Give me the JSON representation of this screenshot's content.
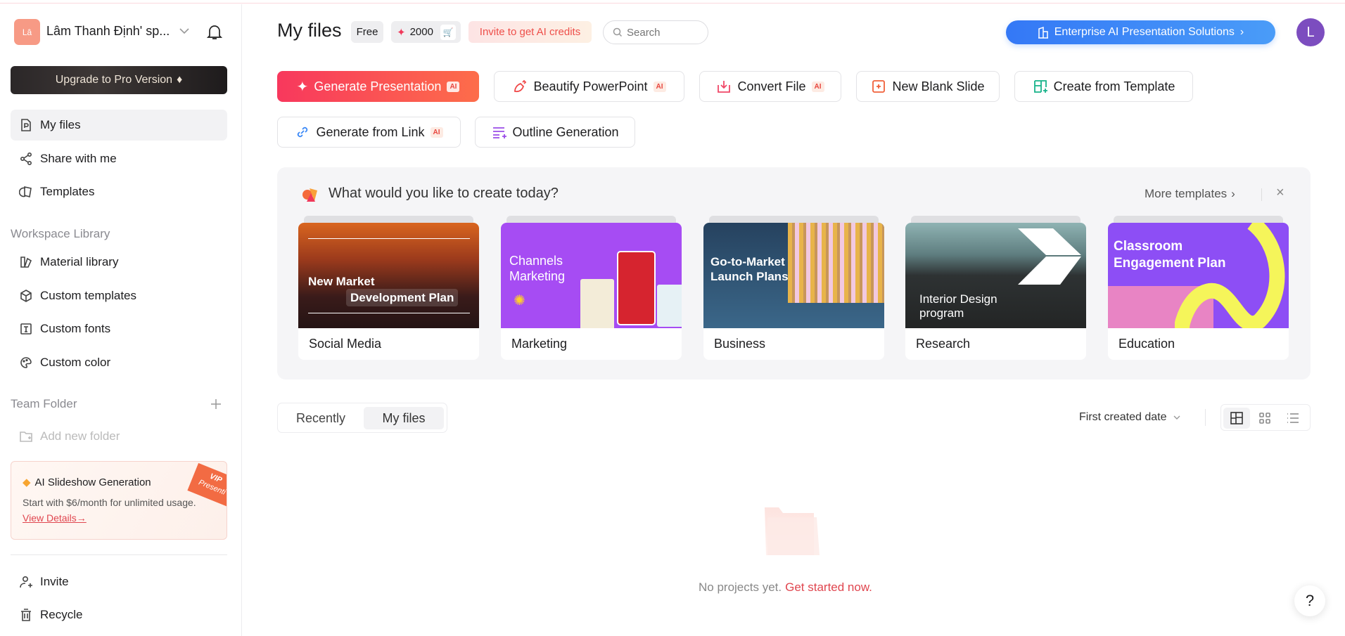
{
  "sidebar": {
    "workspace_avatar": "Lâ",
    "workspace_name": "Lâm Thanh Định' sp...",
    "upgrade_label": "Upgrade to Pro Version",
    "nav": [
      {
        "label": "My files",
        "icon": "file-icon",
        "active": true
      },
      {
        "label": "Share with me",
        "icon": "share-icon"
      },
      {
        "label": "Templates",
        "icon": "templates-icon"
      }
    ],
    "workspace_library_title": "Workspace Library",
    "library": [
      {
        "label": "Material library",
        "icon": "material-icon"
      },
      {
        "label": "Custom templates",
        "icon": "cube-icon"
      },
      {
        "label": "Custom fonts",
        "icon": "font-icon"
      },
      {
        "label": "Custom color",
        "icon": "palette-icon"
      }
    ],
    "team_folder_title": "Team Folder",
    "add_folder_label": "Add new folder",
    "promo": {
      "title": "AI Slideshow Generation",
      "text": "Start with $6/month for unlimited usage.",
      "link": "View Details→",
      "ribbon_top": "VIP",
      "ribbon_bottom": "Presenti"
    },
    "bottom": [
      {
        "label": "Invite",
        "icon": "invite-icon"
      },
      {
        "label": "Recycle",
        "icon": "trash-icon"
      }
    ]
  },
  "header": {
    "title": "My files",
    "plan": "Free",
    "credits": "2000",
    "invite_label": "Invite to get AI credits",
    "search_placeholder": "Search",
    "enterprise_label": "Enterprise AI Presentation Solutions",
    "user_initial": "L"
  },
  "actions": [
    {
      "label": "Generate Presentation",
      "ai": "AI"
    },
    {
      "label": "Beautify PowerPoint",
      "ai": "AI"
    },
    {
      "label": "Convert File",
      "ai": "AI"
    },
    {
      "label": "New Blank Slide"
    },
    {
      "label": "Create from Template"
    },
    {
      "label": "Generate from Link",
      "ai": "AI"
    },
    {
      "label": "Outline Generation"
    }
  ],
  "templates_panel": {
    "title": "What would you like to create today?",
    "more_label": "More templates",
    "cards": [
      {
        "label": "Social Media",
        "line1": "New Market",
        "line2": "Development Plan"
      },
      {
        "label": "Marketing",
        "line1": "Channels",
        "line2": "Marketing"
      },
      {
        "label": "Business",
        "line1": "Go-to-Market",
        "line2": "Launch Plans"
      },
      {
        "label": "Research",
        "line1": "Interior Design",
        "line2": "program"
      },
      {
        "label": "Education",
        "line1": "Classroom",
        "line2": "Engagement Plan"
      }
    ]
  },
  "files": {
    "tabs": [
      "Recently",
      "My files"
    ],
    "active_tab": "My files",
    "sort_label": "First created date",
    "views": [
      "large-grid-icon",
      "grid-icon",
      "list-icon"
    ],
    "active_view": "large-grid-icon",
    "empty_text": "No projects yet.",
    "empty_link": "Get started now."
  },
  "help_label": "?",
  "colors": {
    "accent": "#f8435f",
    "enterprise": "#3b82f6",
    "user_avatar": "#7c4dbf",
    "link": "#e0464f"
  }
}
